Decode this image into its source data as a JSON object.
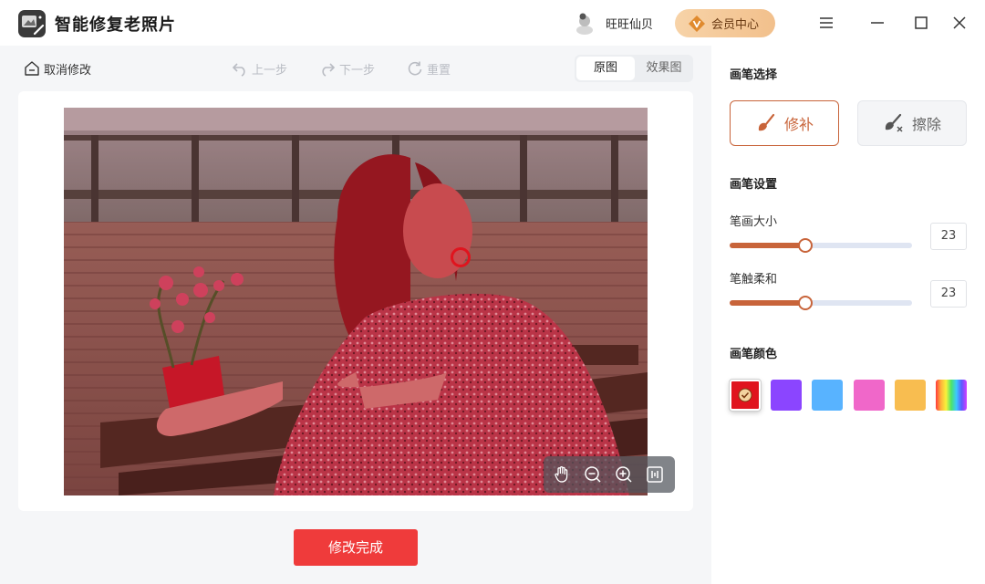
{
  "app": {
    "title": "智能修复老照片"
  },
  "header": {
    "user_name": "旺旺仙贝",
    "vip_label": "会员中心",
    "icons": [
      "app-logo-icon",
      "user-avatar-icon",
      "vip-badge-icon",
      "menu-icon",
      "minimize-icon",
      "maximize-icon",
      "close-icon"
    ]
  },
  "toolbar": {
    "cancel_label": "取消修改",
    "undo_label": "上一步",
    "redo_label": "下一步",
    "reset_label": "重置",
    "view_original": "原图",
    "view_result": "效果图"
  },
  "canvas": {
    "zoom_tools": [
      "hand-icon",
      "zoom-out-icon",
      "zoom-in-icon",
      "fit-screen-icon"
    ]
  },
  "actions": {
    "done_label": "修改完成"
  },
  "panel": {
    "brush_select_title": "画笔选择",
    "brush_repair_label": "修补",
    "brush_erase_label": "擦除",
    "brush_settings_title": "画笔设置",
    "size_label": "笔画大小",
    "size_value": "23",
    "softness_label": "笔触柔和",
    "softness_value": "23",
    "color_title": "画笔颜色"
  },
  "colors": {
    "accent": "#c8643a",
    "done_button": "#ef3b3b",
    "swatches": [
      "#e0141e",
      "#8b45ff",
      "#58b3ff",
      "#f067c9",
      "#f8bd50",
      "rainbow"
    ],
    "selected_swatch": "#e0141e"
  }
}
